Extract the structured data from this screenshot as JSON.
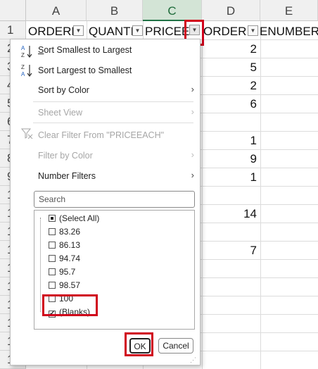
{
  "sheet": {
    "columns": [
      "A",
      "B",
      "C",
      "D",
      "E"
    ],
    "row_numbers": [
      "1",
      "2",
      "3",
      "4",
      "5",
      "6",
      "7",
      "8",
      "9",
      "1",
      "1",
      "1",
      "1",
      "1",
      "1",
      "1",
      "1",
      "1",
      "1",
      "2"
    ],
    "header_row": {
      "A": "ORDERN",
      "B": "QUANTI",
      "C": "PRICEEA",
      "D": "ORDERLI",
      "E": "ENUMBER"
    },
    "column_d_values": [
      {
        "row": 2,
        "value": "2"
      },
      {
        "row": 3,
        "value": "5"
      },
      {
        "row": 4,
        "value": "2"
      },
      {
        "row": 5,
        "value": "6"
      },
      {
        "row": 7,
        "value": "1"
      },
      {
        "row": 8,
        "value": "9"
      },
      {
        "row": 9,
        "value": "1"
      },
      {
        "row": 11,
        "value": "14"
      },
      {
        "row": 13,
        "value": "7"
      }
    ],
    "filter_arrow_icon": "chevron-down-icon"
  },
  "filter_menu": {
    "items": [
      {
        "icon": "sort-ascending-icon",
        "prefix": "S",
        "label": "ort Smallest to Largest"
      },
      {
        "icon": "sort-descending-icon",
        "prefix": "",
        "label": "Sort Largest to Smallest"
      },
      {
        "icon": "",
        "prefix": "",
        "label": "Sort by Color"
      },
      {
        "icon": "",
        "prefix": "",
        "label": "Sheet View"
      },
      {
        "icon": "clear-filter-icon",
        "prefix": "",
        "label": "Clear Filter From \"PRICEEACH\""
      },
      {
        "icon": "",
        "prefix": "",
        "label": "Filter by Color"
      },
      {
        "icon": "",
        "prefix": "",
        "label": "Number Filters"
      }
    ],
    "search_placeholder": "Search",
    "values": [
      {
        "label": "(Select All)",
        "state": "partial"
      },
      {
        "label": "83.26",
        "state": "unchecked"
      },
      {
        "label": "86.13",
        "state": "unchecked"
      },
      {
        "label": "94.74",
        "state": "unchecked"
      },
      {
        "label": "95.7",
        "state": "unchecked"
      },
      {
        "label": "98.57",
        "state": "unchecked"
      },
      {
        "label": "100",
        "state": "unchecked"
      },
      {
        "label": "(Blanks)",
        "state": "checked"
      }
    ],
    "ok_label": "OK",
    "cancel_label": "Cancel"
  },
  "colors": {
    "highlight": "#d0021b",
    "selected_header_bg": "#d3e4d6",
    "selected_header_fg": "#1e6b3a"
  }
}
